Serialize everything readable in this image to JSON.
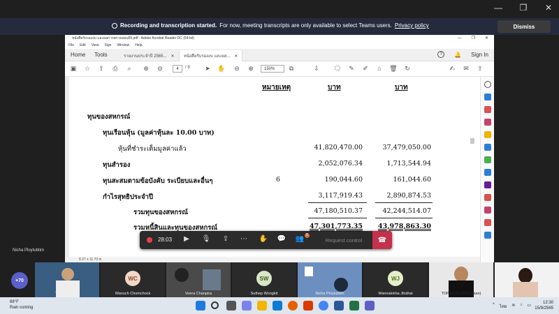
{
  "teams": {
    "banner_title": "Recording and transcription started.",
    "banner_text": "For now, meeting transcripts are only available to select Teams users.",
    "banner_link": "Privacy policy",
    "dismiss": "Dismiss",
    "presenter_name": "Nicha Ploytubtim"
  },
  "acrobat": {
    "window_title": "หนังสือรับรองงบ และผลการตรวจสอบ65.pdf - Adobe Acrobat Reader DC (64-bit)",
    "menu": [
      "File",
      "Edit",
      "View",
      "Sign",
      "Window",
      "Help"
    ],
    "tabs": {
      "home": "Home",
      "tools": "Tools",
      "doc1": "รายงานประจำปี 2565...",
      "doc2": "หนังสือรับรองงบ และผล..."
    },
    "sign_in": "Sign In",
    "page_current": "4",
    "page_total": "/ 9",
    "zoom": "150%",
    "status_size": "8.27 x 11.70 in"
  },
  "document": {
    "col_note": "หมายเหตุ",
    "col_baht1": "บาท",
    "col_baht2": "บาท",
    "rows": [
      {
        "label": "ทุนของสหกรณ์",
        "note": "",
        "v1": "",
        "v2": ""
      },
      {
        "label": "ทุนเรือนหุ้น (มูลค่าหุ้นละ 10.00 บาท)",
        "note": "",
        "v1": "",
        "v2": ""
      },
      {
        "label": "หุ้นที่ชำระเต็มมูลค่าแล้ว",
        "note": "",
        "v1": "41,820,470.00",
        "v2": "37,479,050.00"
      },
      {
        "label": "ทุนสำรอง",
        "note": "",
        "v1": "2,052,076.34",
        "v2": "1,713,544.94"
      },
      {
        "label": "ทุนสะสมตามข้อบังคับ ระเบียบและอื่นๆ",
        "note": "6",
        "v1": "190,044.60",
        "v2": "161,044.60"
      },
      {
        "label": "กำไรสุทธิประจำปี",
        "note": "",
        "v1": "3,117,919.43",
        "v2": "2,890,874.53"
      },
      {
        "label": "รวมทุนของสหกรณ์",
        "note": "",
        "v1": "47,180,510.37",
        "v2": "42,244,514.07"
      },
      {
        "label": "รวมหนี้สินและทุนของสหกรณ์",
        "note": "",
        "v1": "47,301,773.35",
        "v2": "43,978,863.30"
      }
    ]
  },
  "meeting_controls": {
    "timer": "28:03",
    "participants_badge": "5",
    "request_control": "Request control"
  },
  "gallery": {
    "more_count": "+70",
    "participants": [
      {
        "name": "Tanawat Bhad",
        "initials": ""
      },
      {
        "name": "Wanuch Chomchock",
        "initials": "WC"
      },
      {
        "name": "Veera Chanpira",
        "initials": ""
      },
      {
        "name": "Suthep Wongkit",
        "initials": "SW"
      },
      {
        "name": "Nicha Ploytubtim",
        "initials": ""
      },
      {
        "name": "Wannalekha Jituthai",
        "initials": "WJ"
      },
      {
        "name": "TOP ACFS (Phongsan)",
        "initials": ""
      },
      {
        "name": "",
        "initials": ""
      }
    ]
  },
  "taskbar": {
    "temp": "88°F",
    "weather": "Rain coming",
    "lang": "ไทย",
    "time": "12:30",
    "date": "15/9/2565"
  }
}
